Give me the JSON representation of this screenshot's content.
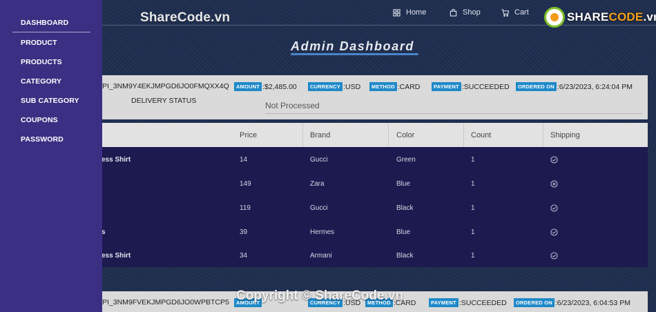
{
  "nav": {
    "home": "Home",
    "shop": "Shop",
    "cart": "Cart"
  },
  "watermark": "ShareCode.vn",
  "logo": {
    "prefix": "SHARE",
    "suffix": "CODE",
    "domain": ".vn"
  },
  "page_title": "Admin Dashboard",
  "sidebar": {
    "items": [
      "DASHBOARD",
      "PRODUCT",
      "PRODUCTS",
      "CATEGORY",
      "SUB CATEGORY",
      "COUPONS",
      "PASSWORD"
    ]
  },
  "order1": {
    "id": "PI_3NM9Y4EKJMPGD6JO0FMQXX4Q",
    "amount_label": "AMOUNT",
    "amount": ":$2,485.00",
    "currency_label": "CURRENCY",
    "currency": ":USD",
    "method_label": "METHOD",
    "method": ":CARD",
    "payment_label": "PAYMENT",
    "payment": ":SUCCEEDED",
    "ordered_label": "ORDERED ON",
    "ordered": ":6/23/2023, 6:24:04 PM",
    "delivery_label": "DELIVERY STATUS",
    "delivery_value": "Not Processed"
  },
  "table": {
    "headers": [
      "Price",
      "Brand",
      "Color",
      "Count",
      "Shipping"
    ],
    "rows": [
      {
        "title": "ess Shirt",
        "price": "14",
        "brand": "Gucci",
        "color": "Green",
        "count": "1",
        "shipping": "check-circle-icon"
      },
      {
        "title": "",
        "price": "149",
        "brand": "Zara",
        "color": "Blue",
        "count": "1",
        "shipping": "x-circle-icon"
      },
      {
        "title": "",
        "price": "119",
        "brand": "Gucci",
        "color": "Black",
        "count": "1",
        "shipping": "check-circle-icon"
      },
      {
        "title": "s",
        "price": "39",
        "brand": "Hermes",
        "color": "Blue",
        "count": "1",
        "shipping": "check-circle-icon"
      },
      {
        "title": "ess Shirt",
        "price": "34",
        "brand": "Armani",
        "color": "Black",
        "count": "1",
        "shipping": "check-circle-icon"
      }
    ]
  },
  "order2": {
    "id": "PI_3NM9FVEKJMPGD6JO0WPBTCP5",
    "amount_label": "AMOUNT",
    "currency_label": "CURRENCY",
    "currency": ":USD",
    "method_label": "METHOD",
    "method": ":CARD",
    "payment_label": "PAYMENT",
    "payment": ":SUCCEEDED",
    "ordered_label": "ORDERED ON",
    "ordered": ":6/23/2023, 6:04:53 PM"
  },
  "copyright": "Copyright © ShareCode.vn",
  "colors": {
    "sidebar": "#3a2f82",
    "badge": "#1f89c9",
    "table_body": "#1c1a4f"
  }
}
